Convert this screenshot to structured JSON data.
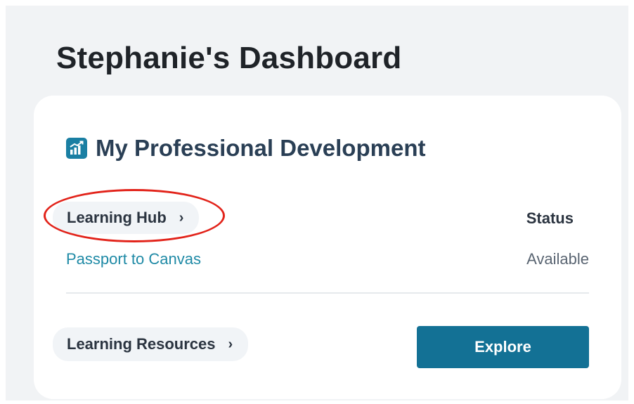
{
  "page": {
    "title": "Stephanie's Dashboard"
  },
  "card": {
    "icon": "chart-icon",
    "title": "My Professional Development",
    "learning_hub": {
      "label": "Learning Hub",
      "chevron": "›",
      "highlighted": true
    },
    "status_header": "Status",
    "courses": [
      {
        "name": "Passport to Canvas",
        "status": "Available"
      }
    ],
    "learning_resources": {
      "label": "Learning Resources",
      "chevron": "›"
    },
    "explore_label": "Explore"
  },
  "colors": {
    "page_background": "#f1f3f5",
    "card_background": "#ffffff",
    "title_text": "#1f2328",
    "card_title_text": "#2a3f55",
    "link": "#1f8aa6",
    "button": "#137195",
    "highlight": "#e2231a",
    "icon": "#1a7fa3"
  }
}
